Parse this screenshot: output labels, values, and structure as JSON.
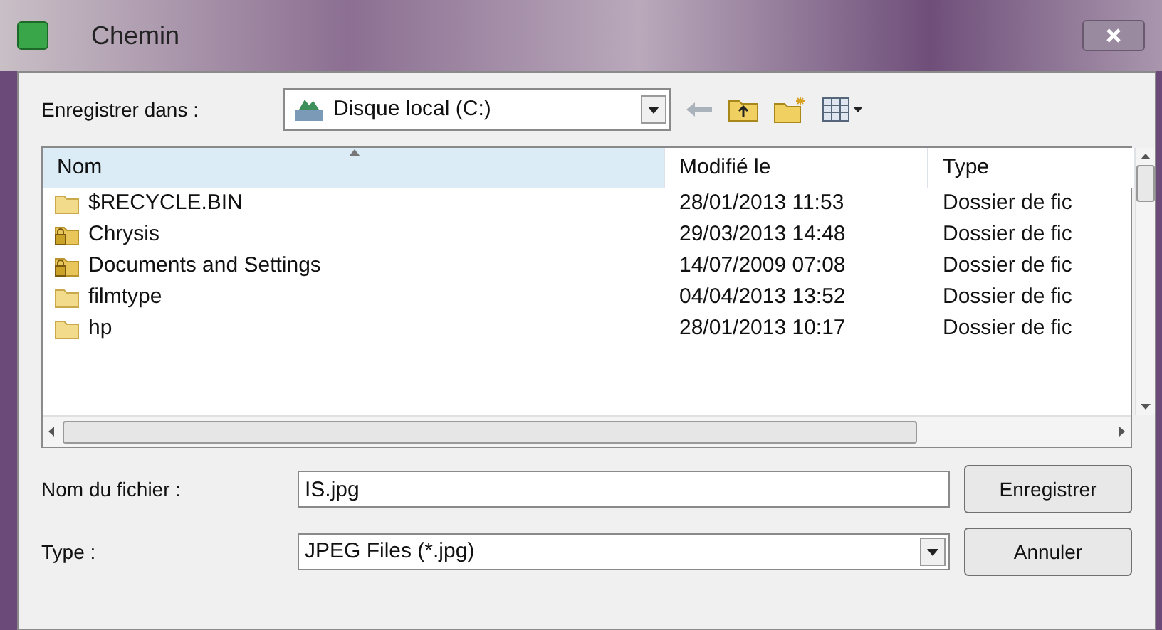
{
  "window": {
    "title": "Chemin"
  },
  "location": {
    "label": "Enregistrer dans :",
    "value": "Disque local (C:)"
  },
  "table": {
    "columns": [
      {
        "label": "Nom",
        "sorted": true
      },
      {
        "label": "Modifié le",
        "sorted": false
      },
      {
        "label": "Type",
        "sorted": false
      }
    ],
    "rows": [
      {
        "kind": "folder",
        "name": "$RECYCLE.BIN",
        "modified": "28/01/2013 11:53",
        "type": "Dossier de fic"
      },
      {
        "kind": "locked",
        "name": "Chrysis",
        "modified": "29/03/2013 14:48",
        "type": "Dossier de fic"
      },
      {
        "kind": "locked",
        "name": "Documents and Settings",
        "modified": "14/07/2009 07:08",
        "type": "Dossier de fic"
      },
      {
        "kind": "folder",
        "name": "filmtype",
        "modified": "04/04/2013 13:52",
        "type": "Dossier de fic"
      },
      {
        "kind": "folder",
        "name": "hp",
        "modified": "28/01/2013 10:17",
        "type": "Dossier de fic"
      }
    ]
  },
  "filename": {
    "label": "Nom du fichier :",
    "value": "IS.jpg"
  },
  "filetype": {
    "label": "Type :",
    "value": "JPEG Files (*.jpg)"
  },
  "buttons": [
    "Enregistrer",
    "Annuler"
  ]
}
